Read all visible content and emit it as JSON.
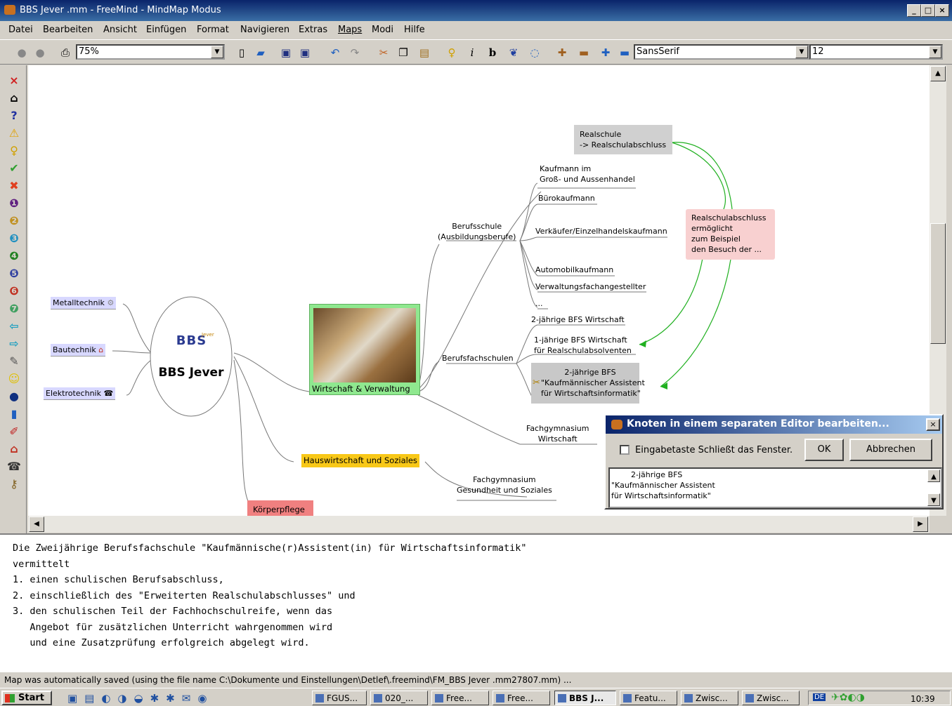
{
  "window": {
    "title": "BBS Jever .mm - FreeMind - MindMap Modus"
  },
  "menu": [
    "Datei",
    "Bearbeiten",
    "Ansicht",
    "Einfügen",
    "Format",
    "Navigieren",
    "Extras",
    "Maps",
    "Modi",
    "Hilfe"
  ],
  "toolbar": {
    "zoom": "75%",
    "font": "SansSerif",
    "font_size": "12"
  },
  "map": {
    "root": "BBS Jever",
    "logo_text": "BBS",
    "logo_sub": "Jever",
    "left_nodes": [
      "Metalltechnik",
      "Bautechnik",
      "Elektrotechnik"
    ],
    "central": "Wirtschaft & Verwaltung",
    "berufsschule": "Berufsschule\n(Ausbildungsberufe)",
    "berufsschule_items": [
      "Kaufmann im\nGroß- und Aussenhandel",
      "Bürokaufmann",
      "Verkäufer/Einzelhandelskaufmann",
      "Automobilkaufmann",
      "Verwaltungsfachangestellter",
      "..."
    ],
    "bfs": "Berufsfachschulen",
    "bfs_items": [
      "2-jährige BFS Wirtschaft",
      "1-jährige BFS Wirtschaft\nfür Realschulabsolventen",
      "2-jährige BFS\n\"Kaufmännischer Assistent\nfür Wirtschaftsinformatik\""
    ],
    "fgw": "Fachgymnasium\nWirtschaft",
    "realschule": "Realschule\n-> Realschulabschluss",
    "realschule_note": "Realschulabschluss\nermöglicht\nzum Beispiel\nden Besuch der ...",
    "hauswirtschaft": "Hauswirtschaft und Soziales",
    "fgg": "Fachgymnasium\nGesundheit und Soziales",
    "koerperpflege": "Körperpflege"
  },
  "dialog": {
    "title": "Knoten in einem separaten Editor bearbeiten...",
    "checkbox": "Eingabetaste Schließt das Fenster.",
    "ok": "OK",
    "cancel": "Abbrechen",
    "text": "        2-jährige BFS\n\"Kaufmännischer Assistent\nfür Wirtschaftsinformatik\""
  },
  "notes": [
    "Die Zweijährige Berufsfachschule \"Kaufmännische(r)Assistent(in) für Wirtschaftsinformatik\"",
    "vermittelt",
    "1. einen schulischen Berufsabschluss,",
    "2. einschließlich des \"Erweiterten Realschulabschlusses\" und",
    "3. den schulischen Teil der Fachhochschulreife, wenn das",
    "   Angebot für zusätzlichen Unterricht wahrgenommen wird",
    "   und eine Zusatzprüfung erfolgreich abgelegt wird."
  ],
  "status": "Map was automatically saved (using the file name C:\\Dokumente und Einstellungen\\Detlef\\.freemind\\FM_BBS Jever .mm27807.mm) ...",
  "taskbar": {
    "start": "Start",
    "tasks": [
      "FGUS...",
      "020_...",
      "Free...",
      "Free...",
      "BBS J...",
      "Featu...",
      "Zwisc...",
      "Zwisc..."
    ],
    "lang": "DE",
    "clock": "10:39"
  }
}
